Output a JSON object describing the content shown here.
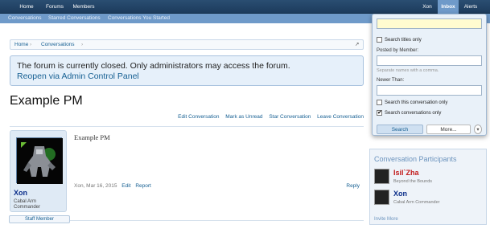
{
  "nav": {
    "tabs": [
      "Home",
      "Forums",
      "Members"
    ],
    "user": "Xon",
    "inbox": "Inbox",
    "alerts": "Alerts"
  },
  "subnav": [
    "Conversations",
    "Starred Conversations",
    "Conversations You Started"
  ],
  "breadcrumb": [
    "Home",
    "Conversations"
  ],
  "notice": {
    "text": "The forum is currently closed. Only administrators may access the forum.",
    "link": "Reopen via Admin Control Panel"
  },
  "page_title": "Example PM",
  "actions": [
    "Edit Conversation",
    "Mark as Unread",
    "Star Conversation",
    "Leave Conversation"
  ],
  "message": {
    "author": "Xon",
    "user_title_1": "Cabal Arm",
    "user_title_2": "Commander",
    "badge": "Staff Member",
    "title": "Example PM",
    "meta": "Xon, Mar 16, 2015",
    "edit": "Edit",
    "report": "Report",
    "reply": "Reply"
  },
  "sidebar": {
    "heading": "Conversation Participants",
    "participants": [
      {
        "name": "Isil`Zha",
        "sub": "Beyond the Bounds",
        "color": "#c21b1b"
      },
      {
        "name": "Xon",
        "sub": "Cabal Arm Commander",
        "color": "#0b2e8a"
      }
    ],
    "invite": "Invite More"
  },
  "search_popup": {
    "query_value": "",
    "titles_only": "Search titles only",
    "posted_by_label": "Posted by Member:",
    "posted_by_value": "",
    "separate_hint": "Separate names with a comma.",
    "newer_than_label": "Newer Than:",
    "newer_than_value": "",
    "this_conv": "Search this conversation only",
    "conv_only": "Search conversations only",
    "conv_only_checked": "✔",
    "search_button": "Search",
    "more_button": "More...",
    "more_icon": "chevron-down"
  },
  "colors": {
    "accent": "#176093",
    "navbar": "#1d3b5c",
    "subnav": "#6f9ac9"
  }
}
